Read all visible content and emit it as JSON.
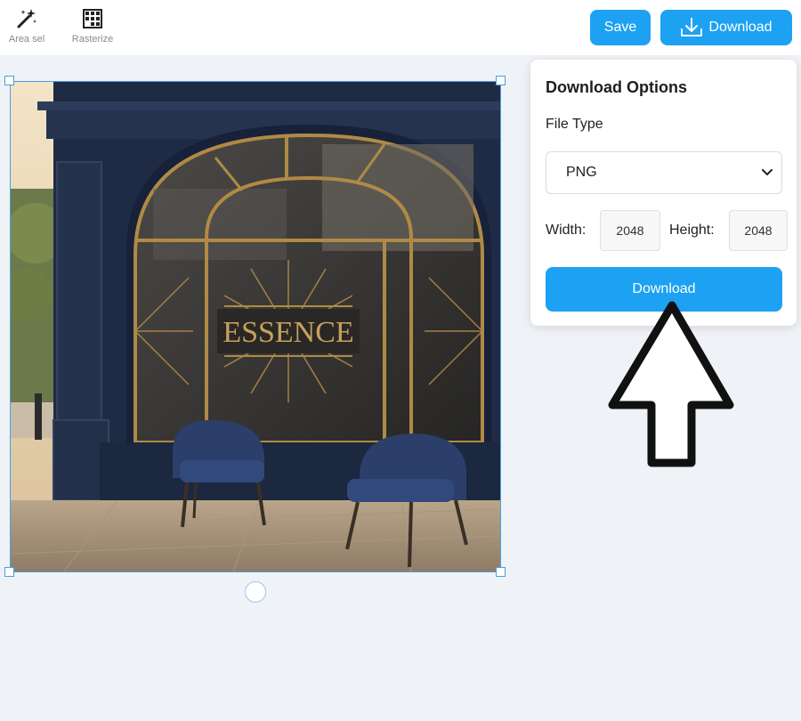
{
  "toolbar": {
    "tools": [
      {
        "label": "Area sel",
        "icon": "magic-wand-icon"
      },
      {
        "label": "Rasterize",
        "icon": "rasterize-grid-icon"
      }
    ],
    "save_label": "Save",
    "download_label": "Download"
  },
  "canvas": {
    "image_text": "ESSENCE"
  },
  "download_panel": {
    "title": "Download Options",
    "file_type_label": "File Type",
    "file_type_value": "PNG",
    "width_label": "Width:",
    "width_value": "2048",
    "height_label": "Height:",
    "height_value": "2048",
    "download_label": "Download"
  },
  "colors": {
    "accent": "#1da1f2",
    "background": "#eff2f6",
    "selection": "#4a9fe0"
  }
}
